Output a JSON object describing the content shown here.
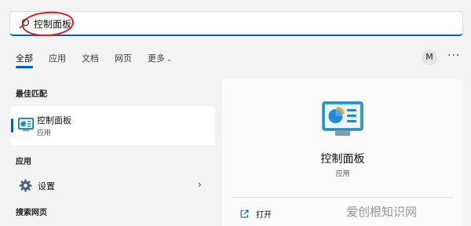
{
  "search": {
    "value": "控制面板"
  },
  "tabs": [
    {
      "label": "全部"
    },
    {
      "label": "应用"
    },
    {
      "label": "文档"
    },
    {
      "label": "网页"
    },
    {
      "label": "更多"
    }
  ],
  "avatar": {
    "initial": "M"
  },
  "more_menu": {
    "label": "···"
  },
  "best_match": {
    "heading": "最佳匹配",
    "title": "控制面板",
    "subtitle": "应用"
  },
  "apps": {
    "heading": "应用",
    "items": [
      {
        "label": "设置",
        "icon": "gear-icon"
      }
    ]
  },
  "web_search": {
    "heading": "搜索网页"
  },
  "details": {
    "title": "控制面板",
    "subtitle": "应用",
    "actions": [
      {
        "label": "打开",
        "icon": "open-external-icon"
      }
    ]
  },
  "watermark": {
    "text": "爱创根知识网"
  },
  "colors": {
    "accent": "#005fb8",
    "annotation": "#d91d1d"
  }
}
